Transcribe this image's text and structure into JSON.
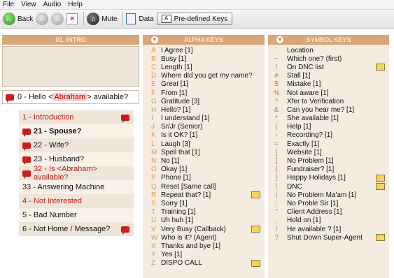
{
  "menu": [
    "File",
    "View",
    "Audio",
    "Help"
  ],
  "toolbar": {
    "back_label": "Back",
    "mute_label": "Mute",
    "data_label": "Data",
    "predefined_label": "Pre-defined Keys"
  },
  "intro": {
    "header": "01. INTRO",
    "greeting_prefix": "0 - Hello <",
    "greeting_name": "Abraham",
    "greeting_suffix": "> available?"
  },
  "scripts": [
    {
      "label": "1 - Introduction",
      "color": "#b81c1c",
      "bold": false,
      "bubble": "right"
    },
    {
      "label": "21 - Spouse?",
      "color": "#111111",
      "bold": true,
      "bubble": "left"
    },
    {
      "label": "22 - Wife?",
      "color": "#111111",
      "bold": false,
      "bubble": "left"
    },
    {
      "label": "23 - Husband?",
      "color": "#111111",
      "bold": false,
      "bubble": "left"
    },
    {
      "label": "32 - Is <Abraham> available?",
      "color": "#b81c1c",
      "bold": false,
      "bubble": "left"
    },
    {
      "label": "33 - Answering Machine",
      "color": "#111111",
      "bold": false,
      "bubble": "none"
    },
    {
      "label": "4 - Not Interested",
      "color": "#b81c1c",
      "bold": false,
      "bubble": "none"
    },
    {
      "label": "5 - Bad Number",
      "color": "#111111",
      "bold": false,
      "bubble": "none"
    },
    {
      "label": "6 - Not Home / Message?",
      "color": "#111111",
      "bold": false,
      "bubble": "right"
    }
  ],
  "alpha": {
    "header": "ALPHA KEYS",
    "items": [
      {
        "key": "A",
        "label": "I Agree [1]"
      },
      {
        "key": "B",
        "label": "Busy [1]"
      },
      {
        "key": "C",
        "label": "Length [1]"
      },
      {
        "key": "D",
        "label": "Where did you get my name?"
      },
      {
        "key": "E",
        "label": "Great [1]"
      },
      {
        "key": "F",
        "label": "From [1]"
      },
      {
        "key": "G",
        "label": "Gratitude [3]"
      },
      {
        "key": "H",
        "label": "Hello? [1]"
      },
      {
        "key": "I",
        "label": "I understand [1]"
      },
      {
        "key": "J",
        "label": "Sr/Jr (Senior)"
      },
      {
        "key": "K",
        "label": "Is it OK? [1]"
      },
      {
        "key": "L",
        "label": "Laugh [3]"
      },
      {
        "key": "M",
        "label": "Spell that [1]"
      },
      {
        "key": "N",
        "label": "No [1]"
      },
      {
        "key": "O",
        "label": "Okay [1]"
      },
      {
        "key": "P",
        "label": "Phone [1]"
      },
      {
        "key": "Q",
        "label": "Reset [Same call]"
      },
      {
        "key": "R",
        "label": "Repeat that? [1]",
        "icon": true
      },
      {
        "key": "S",
        "label": "Sorry [1]"
      },
      {
        "key": "T",
        "label": "Training [1]"
      },
      {
        "key": "U",
        "label": "Uh huh [1]"
      },
      {
        "key": "V",
        "label": "Very Busy (Callback)",
        "icon": true
      },
      {
        "key": "W",
        "label": "Who is it? (Agent)"
      },
      {
        "key": "X",
        "label": "Thanks and bye [1]"
      },
      {
        "key": "Y",
        "label": "Yes [1]"
      },
      {
        "key": "Z",
        "label": "DISPO CALL",
        "icon": true
      }
    ]
  },
  "symbol": {
    "header": "SYMBOL KEYS",
    "items": [
      {
        "key": "`",
        "label": "Location"
      },
      {
        "key": "~",
        "label": "Which one? (first)"
      },
      {
        "key": "!",
        "label": "On DNC list",
        "icon": true
      },
      {
        "key": "#",
        "label": "Stall [1]"
      },
      {
        "key": "$",
        "label": "Mistake [1]"
      },
      {
        "key": "%",
        "label": "Not aware [1]"
      },
      {
        "key": "^",
        "label": "Xfer to Verification"
      },
      {
        "key": "&",
        "label": "Can you hear me? [1]"
      },
      {
        "key": "*",
        "label": "She available [1]"
      },
      {
        "key": "(",
        "label": "Help [1]"
      },
      {
        "key": "-",
        "label": "Recording? [1]"
      },
      {
        "key": "=",
        "label": "Exactly [1]"
      },
      {
        "key": "[",
        "label": "Website [1]"
      },
      {
        "key": "]",
        "label": "No Problem [1]"
      },
      {
        "key": "{",
        "label": "Fundraiser? [1]"
      },
      {
        "key": "}",
        "label": "Happy Holidays [1]",
        "icon": true
      },
      {
        "key": "\\",
        "label": "DNC",
        "icon": true
      },
      {
        "key": "|",
        "label": "No Problem Ma'am [1]"
      },
      {
        "key": ";",
        "label": "No Proble Sir [1]"
      },
      {
        "key": "\"",
        "label": "Client Address [1]"
      },
      {
        "key": ",",
        "label": "Hold on [1]"
      },
      {
        "key": "/",
        "label": "He available ? [1]"
      },
      {
        "key": "?",
        "label": "Shut Down Super-Agent",
        "icon": true
      }
    ]
  }
}
